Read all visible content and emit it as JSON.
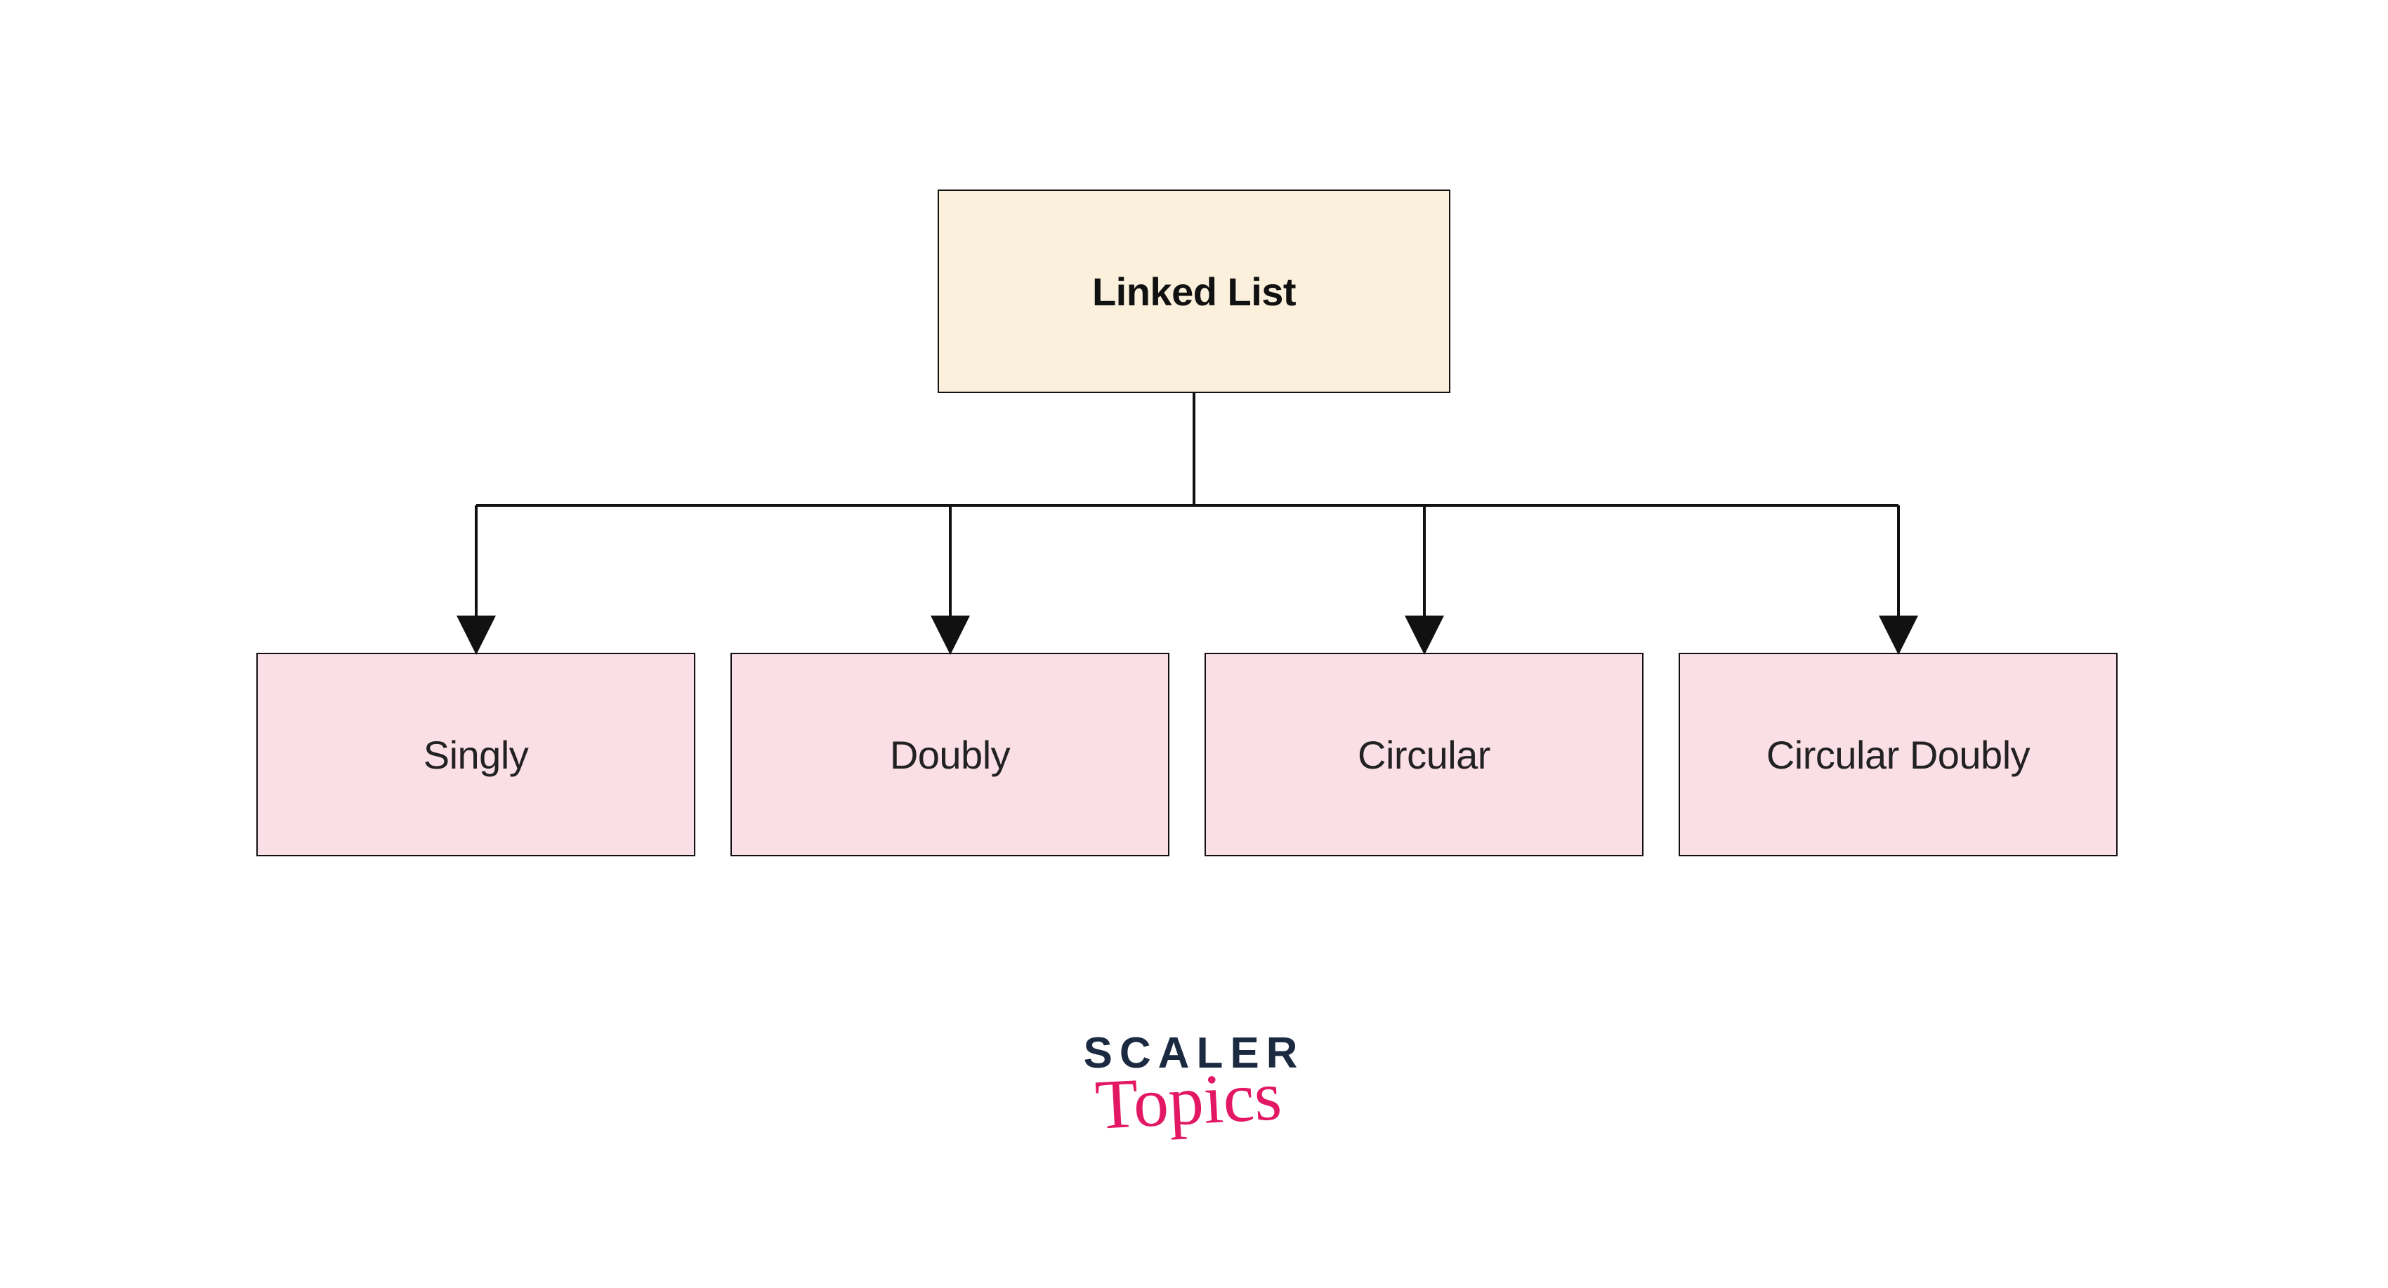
{
  "diagram": {
    "root": {
      "label": "Linked List"
    },
    "children": [
      {
        "label": "Singly"
      },
      {
        "label": "Doubly"
      },
      {
        "label": "Circular"
      },
      {
        "label": "Circular Doubly"
      }
    ]
  },
  "logo": {
    "word1": "SCALER",
    "word2": "Topics"
  },
  "colors": {
    "root_bg": "#faf0dc",
    "child_bg": "#fbdfe6",
    "stroke": "#111111",
    "logo_navy": "#1b2a41",
    "logo_pink": "#e31864"
  }
}
